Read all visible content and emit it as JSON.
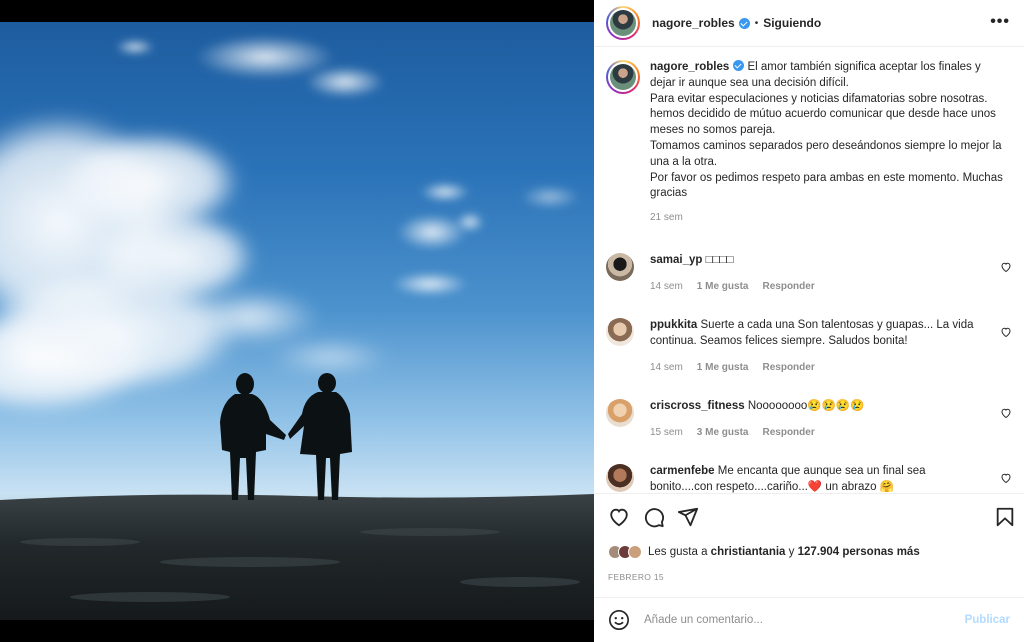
{
  "post": {
    "username": "nagore_robles",
    "follow_status": "Siguiendo",
    "more_label": "•••",
    "caption": [
      "El amor también significa aceptar los finales y dejar ir aunque sea una decisión difícil.",
      "Para evitar especulaciones y noticias difamatorias sobre nosotras. hemos decidido de mútuo acuerdo comunicar que desde hace unos meses no somos pareja.",
      "Tomamos caminos separados pero deseándonos siempre lo mejor la una a la otra.",
      "Por favor os pedimos respeto para ambas en este momento. Muchas gracias"
    ],
    "caption_time": "21 sem"
  },
  "comments": [
    {
      "user": "samai_yp",
      "text": "□□□□",
      "time": "14 sem",
      "likes": "1 Me gusta",
      "reply": "Responder"
    },
    {
      "user": "ppukkita",
      "text": "Suerte a cada una Son talentosas y guapas... La vida continua. Seamos felices siempre. Saludos bonita!",
      "time": "14 sem",
      "likes": "1 Me gusta",
      "reply": "Responder"
    },
    {
      "user": "criscross_fitness",
      "text": "Noooooooo😢😢😢😢",
      "time": "15 sem",
      "likes": "3 Me gusta",
      "reply": "Responder"
    },
    {
      "user": "carmenfebe",
      "text": "Me encanta que aunque sea un final sea bonito....con respeto....cariño...❤️ un abrazo 🤗",
      "time": "",
      "likes": "",
      "reply": ""
    }
  ],
  "likes": {
    "prefix": "Les gusta a",
    "first_user": "christiantania",
    "connector": "y",
    "others": "127.904 personas más"
  },
  "date": "FEBRERO 15",
  "comment_box": {
    "placeholder": "Añade un comentario...",
    "publish": "Publicar"
  },
  "icons": [
    "heart-icon",
    "comment-icon",
    "share-icon",
    "bookmark-icon",
    "emoji-icon",
    "more-icon"
  ],
  "colors": {
    "verified": "#3897f0",
    "link": "#262626",
    "muted": "#8e8e8e",
    "publish_disabled": "#b3dbff"
  }
}
